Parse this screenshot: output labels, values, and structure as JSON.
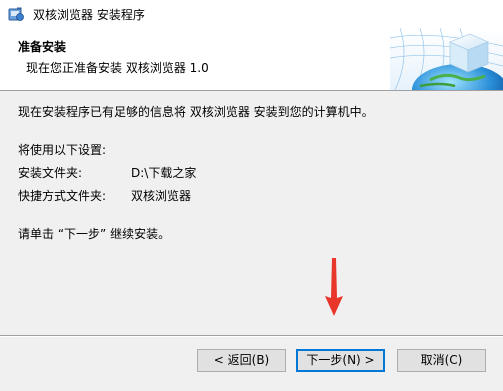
{
  "window": {
    "title": "双核浏览器 安装程序"
  },
  "header": {
    "title": "准备安装",
    "subtitle": "现在您正准备安装 双核浏览器 1.0"
  },
  "content": {
    "intro": "现在安装程序已有足够的信息将 双核浏览器 安装到您的计算机中。",
    "settings_heading": "将使用以下设置:",
    "install_folder_label": "安装文件夹:",
    "install_folder_value": "D:\\下载之家",
    "shortcut_folder_label": "快捷方式文件夹:",
    "shortcut_folder_value": "双核浏览器",
    "instruction": "请单击 “下一步” 继续安装。"
  },
  "buttons": {
    "back": "< 返回(B)",
    "next": "下一步(N) >",
    "cancel": "取消(C)"
  },
  "colors": {
    "arrow": "#e8362b",
    "focus_border": "#0078d7"
  }
}
